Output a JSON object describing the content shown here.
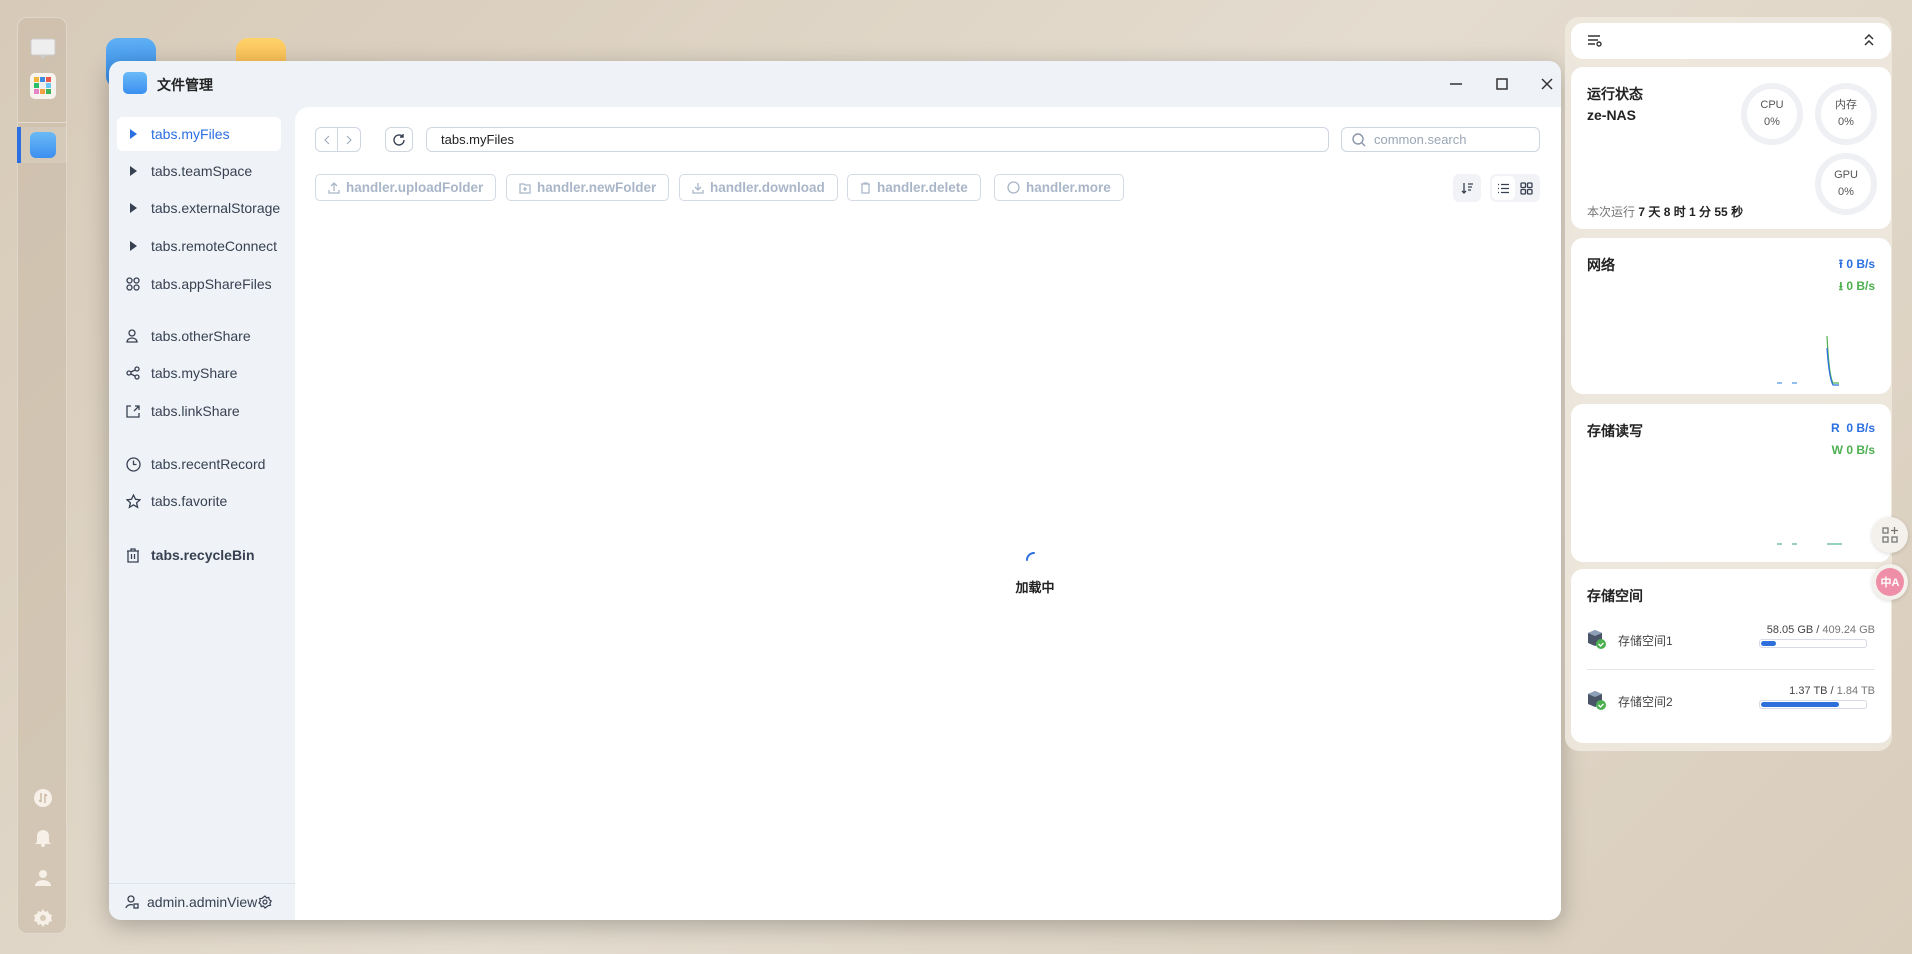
{
  "window": {
    "title": "文件管理",
    "minimize": "minimize",
    "maximize": "maximize",
    "close": "close"
  },
  "sidebar": {
    "items": [
      {
        "label": "tabs.myFiles",
        "icon": "caret-right-icon"
      },
      {
        "label": "tabs.teamSpace",
        "icon": "caret-right-icon"
      },
      {
        "label": "tabs.externalStorage",
        "icon": "caret-right-icon"
      },
      {
        "label": "tabs.remoteConnect",
        "icon": "caret-right-icon"
      },
      {
        "label": "tabs.appShareFiles",
        "icon": "apps-icon"
      },
      {
        "label": "tabs.otherShare",
        "icon": "users-icon"
      },
      {
        "label": "tabs.myShare",
        "icon": "share-icon"
      },
      {
        "label": "tabs.linkShare",
        "icon": "link-share-icon"
      },
      {
        "label": "tabs.recentRecord",
        "icon": "clock-icon"
      },
      {
        "label": "tabs.favorite",
        "icon": "star-icon"
      },
      {
        "label": "tabs.recycleBin",
        "icon": "trash-icon"
      }
    ],
    "footer": "admin.adminView"
  },
  "toolbar": {
    "path": "tabs.myFiles",
    "search_placeholder": "common.search",
    "actions": [
      "handler.uploadFolder",
      "handler.newFolder",
      "handler.download",
      "handler.delete",
      "handler.more"
    ]
  },
  "main": {
    "loading": "加载中"
  },
  "panel": {
    "status": {
      "title": "运行状态",
      "host": "ze-NAS",
      "cpu_label": "CPU",
      "cpu": "0%",
      "mem_label": "内存",
      "mem": "0%",
      "gpu_label": "GPU",
      "gpu": "0%",
      "uptime_label": "本次运行",
      "uptime": "7 天 8 时 1 分 55 秒"
    },
    "network": {
      "title": "网络",
      "up": "0 B/s",
      "down": "0 B/s"
    },
    "disk_io": {
      "title": "存储读写",
      "r_label": "R",
      "r": "0 B/s",
      "w_label": "W",
      "w": "0 B/s"
    },
    "storage": {
      "title": "存储空间",
      "pools": [
        {
          "name": "存储空间1",
          "used": "58.05 GB",
          "total": "409.24 GB",
          "percent": 14
        },
        {
          "name": "存储空间2",
          "used": "1.37 TB",
          "total": "1.84 TB",
          "percent": 74
        }
      ]
    }
  },
  "colors": {
    "accent": "#2b6fe0",
    "green": "#4caf50"
  }
}
